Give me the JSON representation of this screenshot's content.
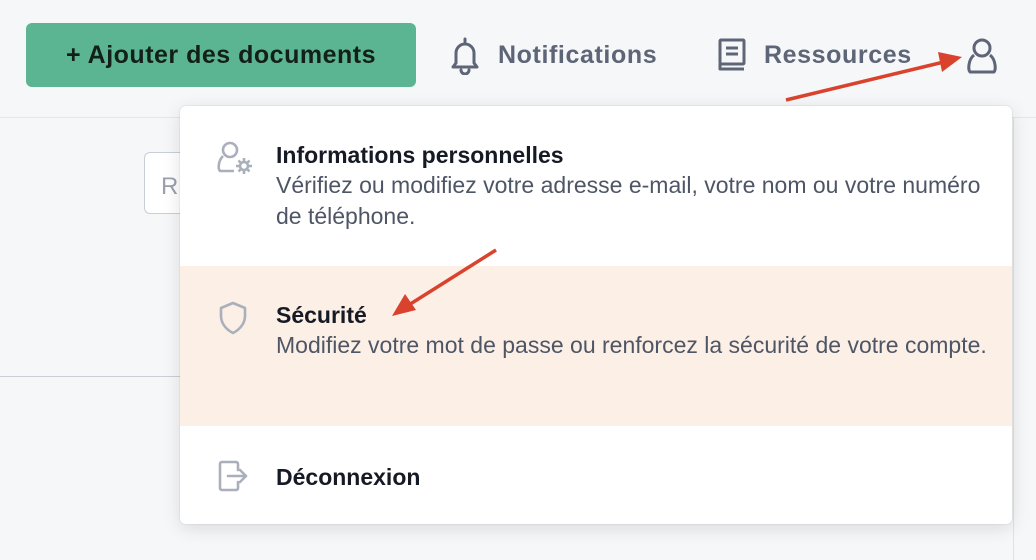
{
  "header": {
    "add_button_label": "+ Ajouter des documents",
    "nav": {
      "notifications_label": "Notifications",
      "resources_label": "Ressources"
    }
  },
  "background": {
    "input_partial_text": "R"
  },
  "menu": {
    "items": [
      {
        "icon": "user-gear-icon",
        "title": "Informations personnelles",
        "description": "Vérifiez ou modifiez votre adresse e-mail, votre nom ou votre numéro de téléphone."
      },
      {
        "icon": "shield-icon",
        "title": "Sécurité",
        "description": "Modifiez votre mot de passe ou renforcez la sécurité de votre compte.",
        "highlighted": true
      },
      {
        "icon": "logout-icon",
        "title": "Déconnexion"
      }
    ]
  },
  "colors": {
    "primary_button": "#5cb592",
    "highlight_row": "#fcefe6",
    "annotation_arrow": "#d9432d",
    "nav_text": "#5d6577"
  }
}
